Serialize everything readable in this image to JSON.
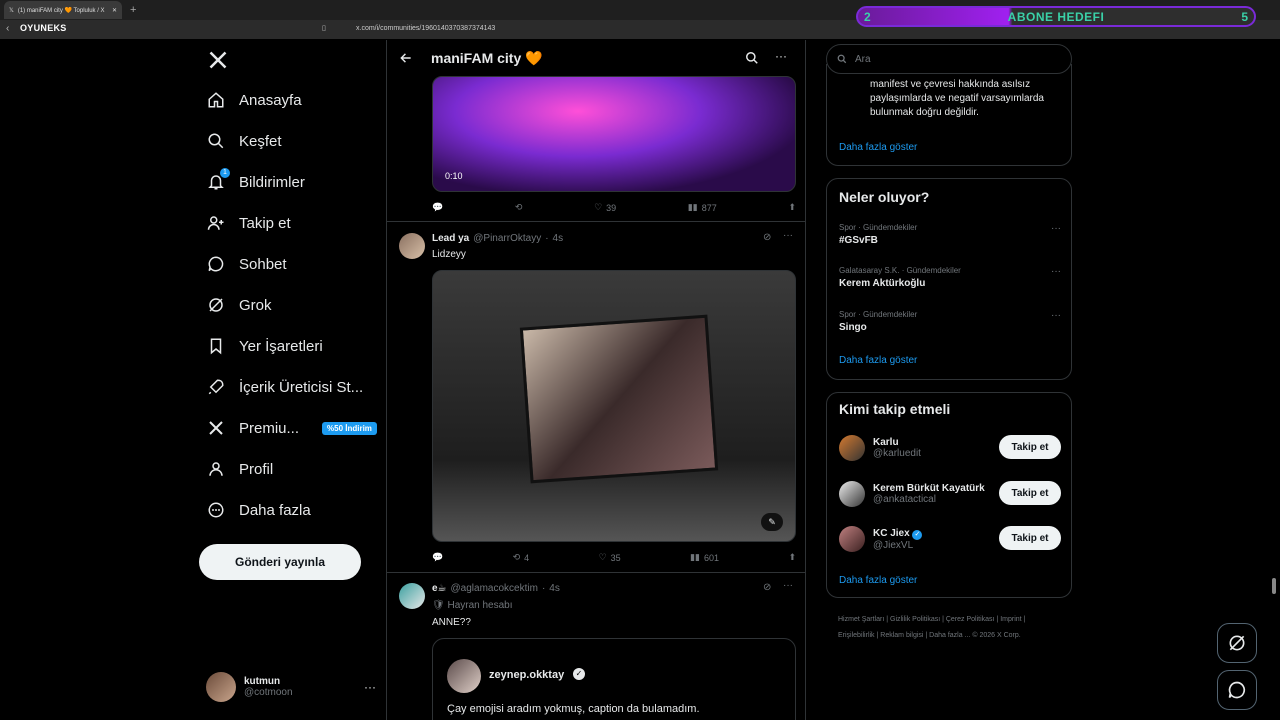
{
  "browser": {
    "tab_title": "(1) maniFAM city 🧡 Topluluk / X",
    "url": "x.com/i/communities/1960140370387374143",
    "brand": "OYUNEKS"
  },
  "stream_overlay": {
    "left": "2",
    "label": "ABONE HEDEFI",
    "right": "5"
  },
  "sidebar": {
    "items": [
      {
        "label": "Anasayfa"
      },
      {
        "label": "Keşfet"
      },
      {
        "label": "Bildirimler",
        "count": "1"
      },
      {
        "label": "Takip et"
      },
      {
        "label": "Sohbet"
      },
      {
        "label": "Grok"
      },
      {
        "label": "Yer İşaretleri"
      },
      {
        "label": "İçerik Üreticisi St..."
      },
      {
        "label": "Premiu...",
        "badge": "%50 İndirim"
      },
      {
        "label": "Profil"
      },
      {
        "label": "Daha fazla"
      }
    ],
    "post_button": "Gönderi yayınla",
    "user": {
      "name": "kutmun",
      "handle": "@cotmoon"
    }
  },
  "header": {
    "title": "maniFAM city 🧡"
  },
  "tweets": [
    {
      "video_time": "0:10",
      "retweets": "",
      "likes": "39",
      "views": "877"
    },
    {
      "name": "Lead ya",
      "handle": "@PinarrOktayy",
      "time": "4s",
      "text": "Lidzeyy",
      "retweets": "4",
      "likes": "35",
      "views": "601"
    },
    {
      "name": "e☕",
      "handle": "@aglamacokcektim",
      "time": "4s",
      "role": "🛡 Hayran hesabı",
      "text": "ANNE??",
      "quote": {
        "name": "zeynep.okktay",
        "text": "Çay emojisi aradım yokmuş, caption da bulamadım."
      }
    }
  ],
  "right": {
    "search_placeholder": "Ara",
    "rules_text": "manifest ve çevresi hakkında asılsız paylaşımlarda ve negatif varsayımlarda bulunmak doğru değildir.",
    "show_more": "Daha fazla göster",
    "trends_title": "Neler oluyor?",
    "trends": [
      {
        "ctx": "Spor · Gündemdekiler",
        "title": "#GSvFB"
      },
      {
        "ctx": "Galatasaray S.K. · Gündemdekiler",
        "title": "Kerem Aktürkoğlu"
      },
      {
        "ctx": "Spor · Gündemdekiler",
        "title": "Singo"
      }
    ],
    "who_title": "Kimi takip etmeli",
    "who": [
      {
        "name": "Karlu",
        "handle": "@karluedit"
      },
      {
        "name": "Kerem Bürküt Kayatürk",
        "handle": "@ankatactical"
      },
      {
        "name": "KC Jiex",
        "handle": "@JiexVL"
      }
    ],
    "follow_label": "Takip et",
    "footer": "Hizmet Şartları | Gizlilik Politikası | Çerez Politikası | Imprint | Erişilebilirlik | Reklam bilgisi | Daha fazla ... © 2026 X Corp."
  },
  "colors": {
    "accent": "#1d9bf0",
    "bg": "#000000",
    "border": "#2f3336"
  }
}
